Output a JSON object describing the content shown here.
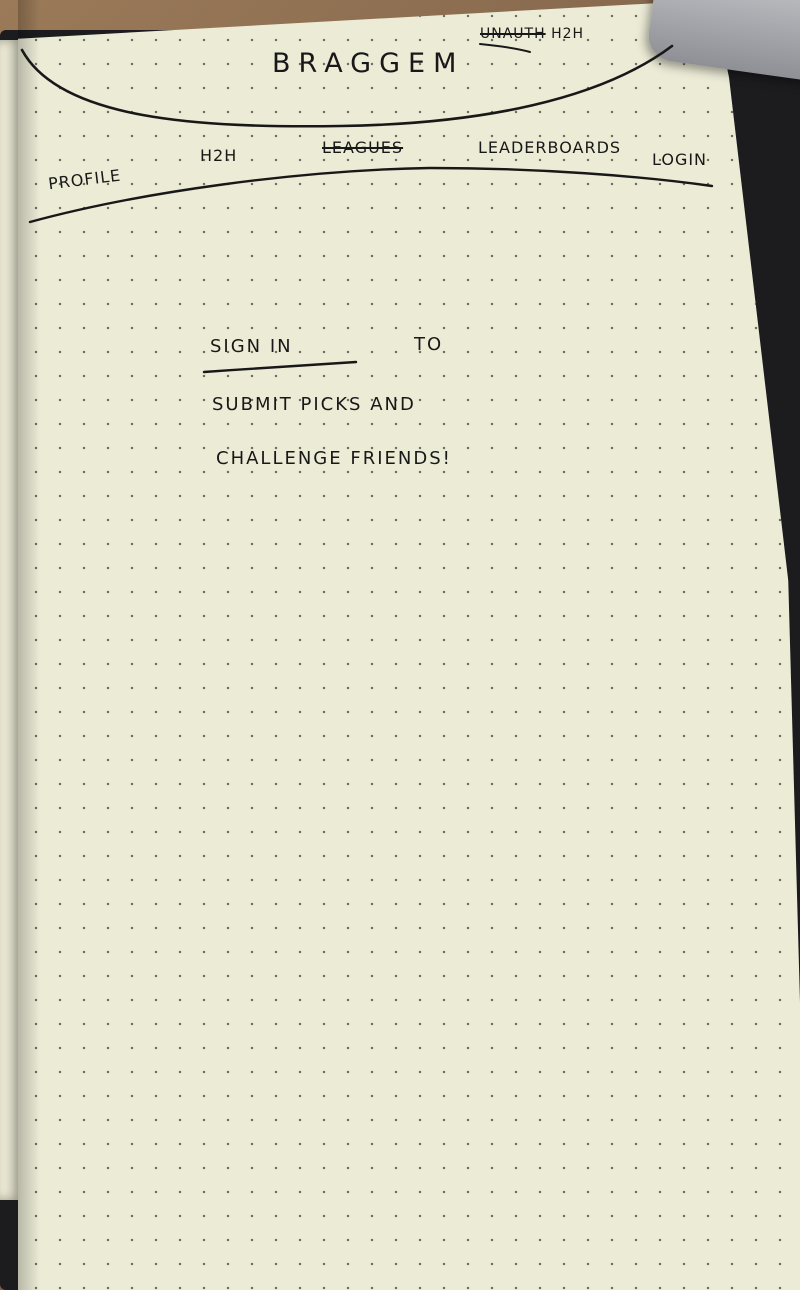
{
  "header": {
    "brand": "BRAGGEM",
    "corner_note_struck": "UNAUTH",
    "corner_note": "H2H"
  },
  "nav": {
    "items": [
      {
        "label": "PROFILE",
        "struck": false
      },
      {
        "label": "H2H",
        "struck": false
      },
      {
        "label": "LEAGUES",
        "struck": true
      },
      {
        "label": "LEADERBOARDS",
        "struck": false
      },
      {
        "label": "LOGIN",
        "struck": false
      }
    ]
  },
  "main": {
    "sign_in_link": "SIGN IN",
    "sign_in_suffix": "TO",
    "line2": "SUBMIT PICKS AND",
    "line3": "CHALLENGE FRIENDS!"
  },
  "colors": {
    "ink": "#181818",
    "paper": "#ecebd6",
    "dot": "#6f6f66",
    "cover": "#1c1c1f"
  }
}
